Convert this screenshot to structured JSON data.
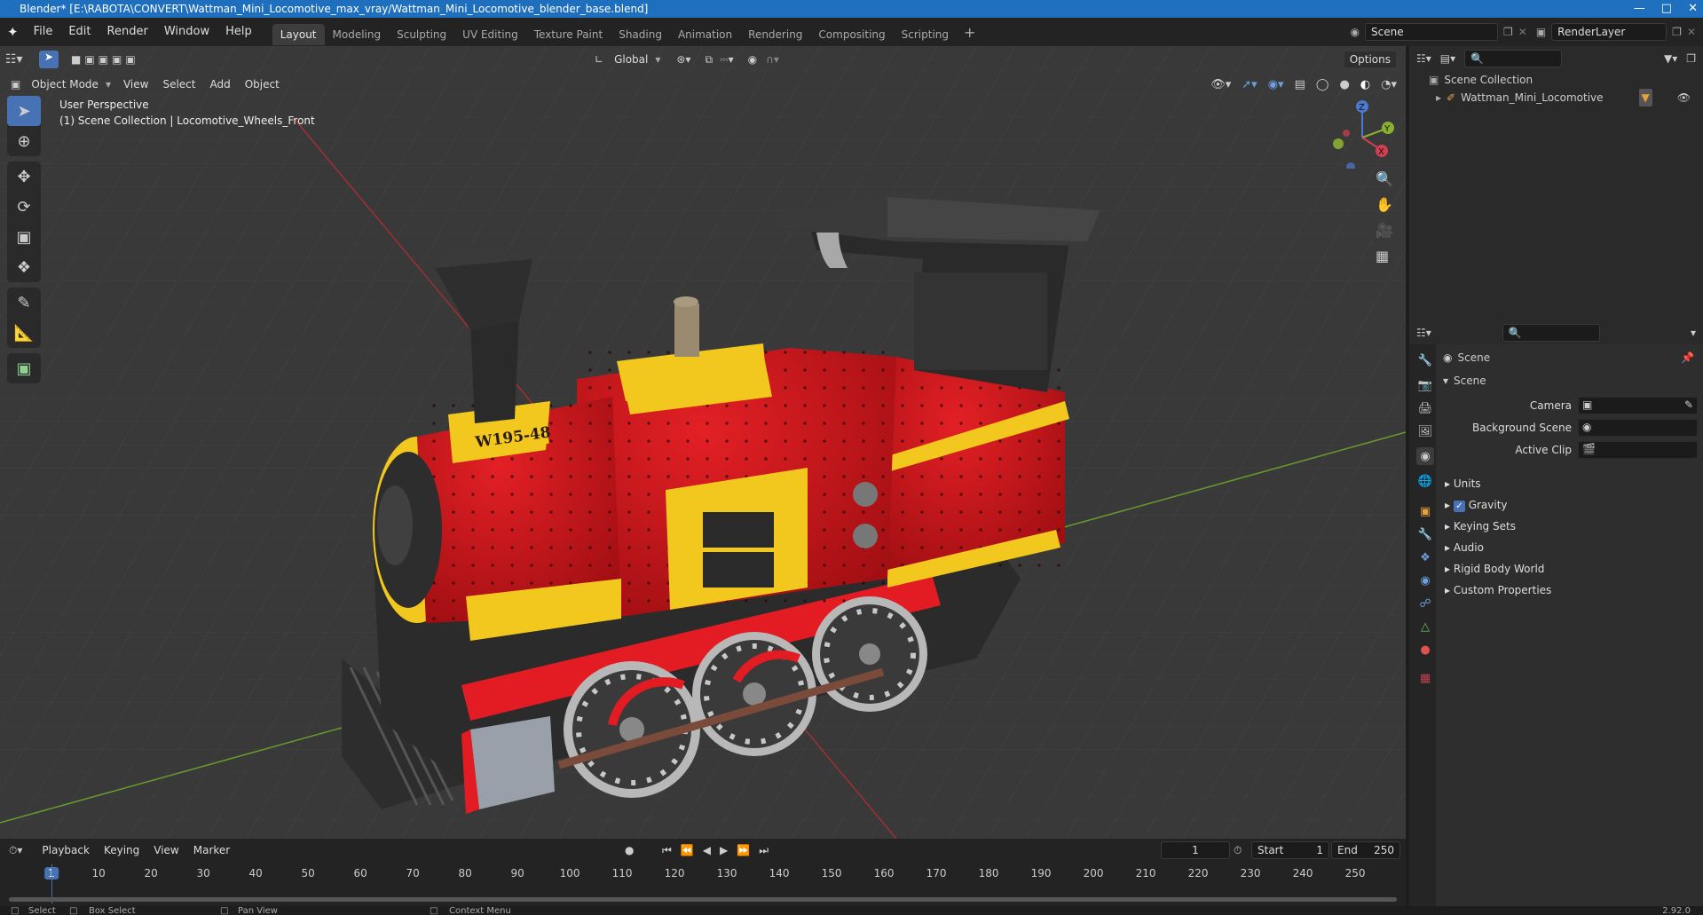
{
  "window": {
    "title": "Blender* [E:\\RABOTA\\CONVERT\\Wattman_Mini_Locomotive_max_vray/Wattman_Mini_Locomotive_blender_base.blend]"
  },
  "menus": [
    "File",
    "Edit",
    "Render",
    "Window",
    "Help"
  ],
  "workspaces": [
    "Layout",
    "Modeling",
    "Sculpting",
    "UV Editing",
    "Texture Paint",
    "Shading",
    "Animation",
    "Rendering",
    "Compositing",
    "Scripting"
  ],
  "scene": {
    "name": "Scene",
    "layer": "RenderLayer"
  },
  "viewport": {
    "mode": "Object Mode",
    "menus": [
      "View",
      "Select",
      "Add",
      "Object"
    ],
    "transform_orientation": "Global",
    "options": "Options",
    "overlay_line1": "User Perspective",
    "overlay_line2": "(1) Scene Collection | Locomotive_Wheels_Front",
    "gizmo": {
      "z": "Z",
      "y": "Y",
      "x": "X"
    },
    "plate_text": "W195-48"
  },
  "outliner": {
    "root": "Scene Collection",
    "item": "Wattman_Mini_Locomotive"
  },
  "properties": {
    "header": "Scene",
    "panel": "Scene",
    "fields": [
      {
        "label": "Camera"
      },
      {
        "label": "Background Scene"
      },
      {
        "label": "Active Clip"
      }
    ],
    "subpanels": [
      "Units",
      "Gravity",
      "Keying Sets",
      "Audio",
      "Rigid Body World",
      "Custom Properties"
    ],
    "gravity_checked": true
  },
  "timeline": {
    "menus": [
      "Playback",
      "Keying",
      "View",
      "Marker"
    ],
    "current_frame": "1",
    "start_label": "Start",
    "start": "1",
    "end_label": "End",
    "end": "250",
    "ticks": [
      "1",
      "10",
      "20",
      "30",
      "40",
      "50",
      "60",
      "70",
      "80",
      "90",
      "100",
      "110",
      "120",
      "130",
      "140",
      "150",
      "160",
      "170",
      "180",
      "190",
      "200",
      "210",
      "220",
      "230",
      "240",
      "250"
    ]
  },
  "statusbar": {
    "items": [
      "Select",
      "Box Select",
      "Pan View",
      "Context Menu"
    ],
    "version": "2.92.0"
  },
  "colors": {
    "accent": "#4772b3",
    "title_bar": "#1f6fbf",
    "body_red": "#c8141c",
    "trim_yellow": "#f2c81e"
  }
}
